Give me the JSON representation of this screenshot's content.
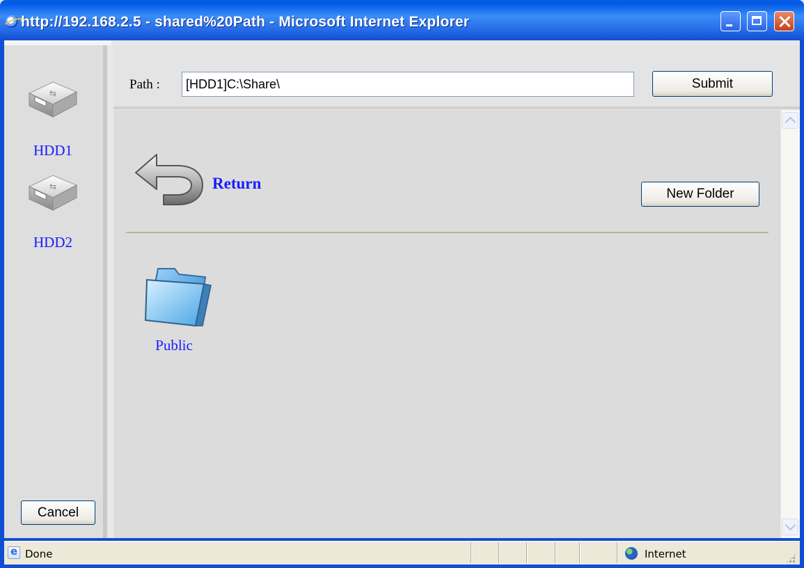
{
  "window": {
    "title": "http://192.168.2.5 - shared%20Path - Microsoft Internet Explorer",
    "controls": [
      "minimize-icon",
      "maximize-icon",
      "close-icon"
    ]
  },
  "sidebar": {
    "drives": [
      {
        "label": "HDD1",
        "icon": "usb-drive-icon"
      },
      {
        "label": "HDD2",
        "icon": "usb-drive-icon"
      }
    ],
    "cancel_label": "Cancel"
  },
  "pathbar": {
    "label": "Path :",
    "value": "[HDD1]C:\\Share\\",
    "submit_label": "Submit"
  },
  "content": {
    "return_label": "Return",
    "new_folder_label": "New Folder",
    "folders": [
      {
        "label": "Public",
        "icon": "folder-icon"
      }
    ]
  },
  "status": {
    "text": "Done",
    "zone": "Internet"
  },
  "colors": {
    "link": "#1a1aff",
    "titlebar": "#0058e6"
  }
}
